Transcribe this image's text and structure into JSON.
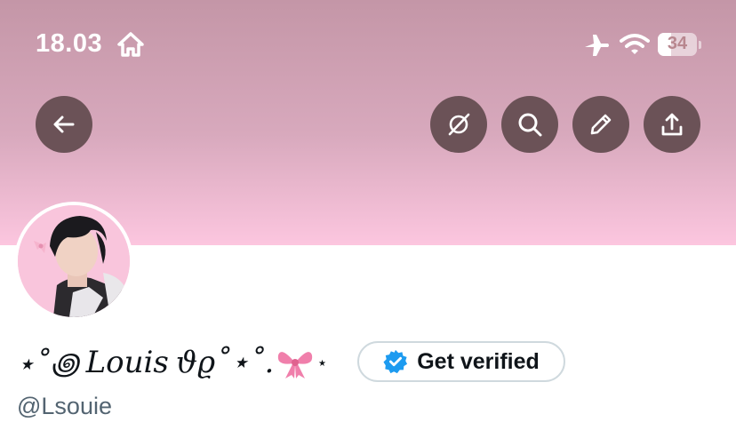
{
  "status_bar": {
    "time": "18.03",
    "battery_level": "34"
  },
  "header": {
    "back_icon": "arrow-left-icon",
    "actions": [
      "circle-slash-icon",
      "search-icon",
      "pencil-icon",
      "share-upload-icon"
    ]
  },
  "profile": {
    "display_name_prefix": "⋆˚꩜",
    "display_name": "Louis",
    "display_name_suffix": "ϑϱ˚⋆˚.",
    "display_name_end": "⋆",
    "verify_button_label": "Get verified",
    "handle": "@Lsouie"
  },
  "colors": {
    "banner_top": "#c496a7",
    "banner_bottom": "#fcc6df",
    "button_bg": "#6b5257",
    "verified_badge": "#1d9bf0",
    "handle_text": "#536471"
  }
}
